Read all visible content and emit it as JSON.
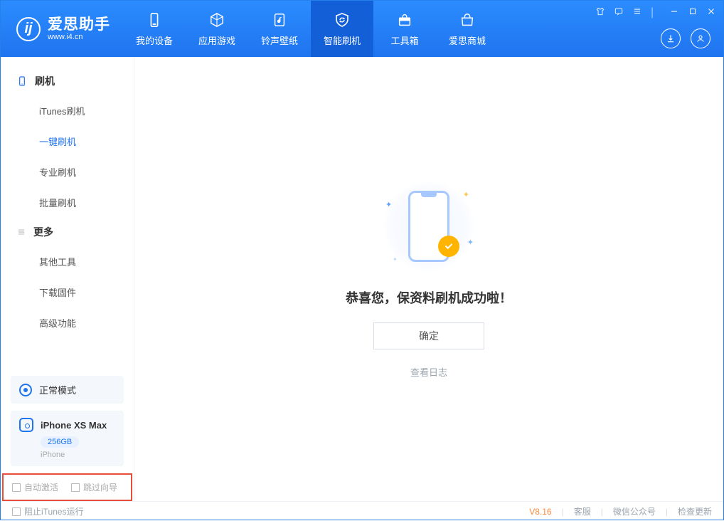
{
  "app": {
    "title": "爱思助手",
    "site": "www.i4.cn"
  },
  "header_tabs": [
    {
      "label": "我的设备"
    },
    {
      "label": "应用游戏"
    },
    {
      "label": "铃声壁纸"
    },
    {
      "label": "智能刷机"
    },
    {
      "label": "工具箱"
    },
    {
      "label": "爱思商城"
    }
  ],
  "sidebar": {
    "section1_title": "刷机",
    "items1": [
      {
        "label": "iTunes刷机"
      },
      {
        "label": "一键刷机"
      },
      {
        "label": "专业刷机"
      },
      {
        "label": "批量刷机"
      }
    ],
    "section2_title": "更多",
    "items2": [
      {
        "label": "其他工具"
      },
      {
        "label": "下载固件"
      },
      {
        "label": "高级功能"
      }
    ]
  },
  "mode": {
    "label": "正常模式"
  },
  "device": {
    "name": "iPhone XS Max",
    "storage": "256GB",
    "type": "iPhone"
  },
  "options": {
    "auto_activate": "自动激活",
    "skip_guide": "跳过向导"
  },
  "main": {
    "success_text": "恭喜您，保资料刷机成功啦！",
    "ok_label": "确定",
    "view_log": "查看日志"
  },
  "footer": {
    "block_itunes": "阻止iTunes运行",
    "version": "V8.16",
    "support": "客服",
    "wechat": "微信公众号",
    "update": "检查更新"
  }
}
